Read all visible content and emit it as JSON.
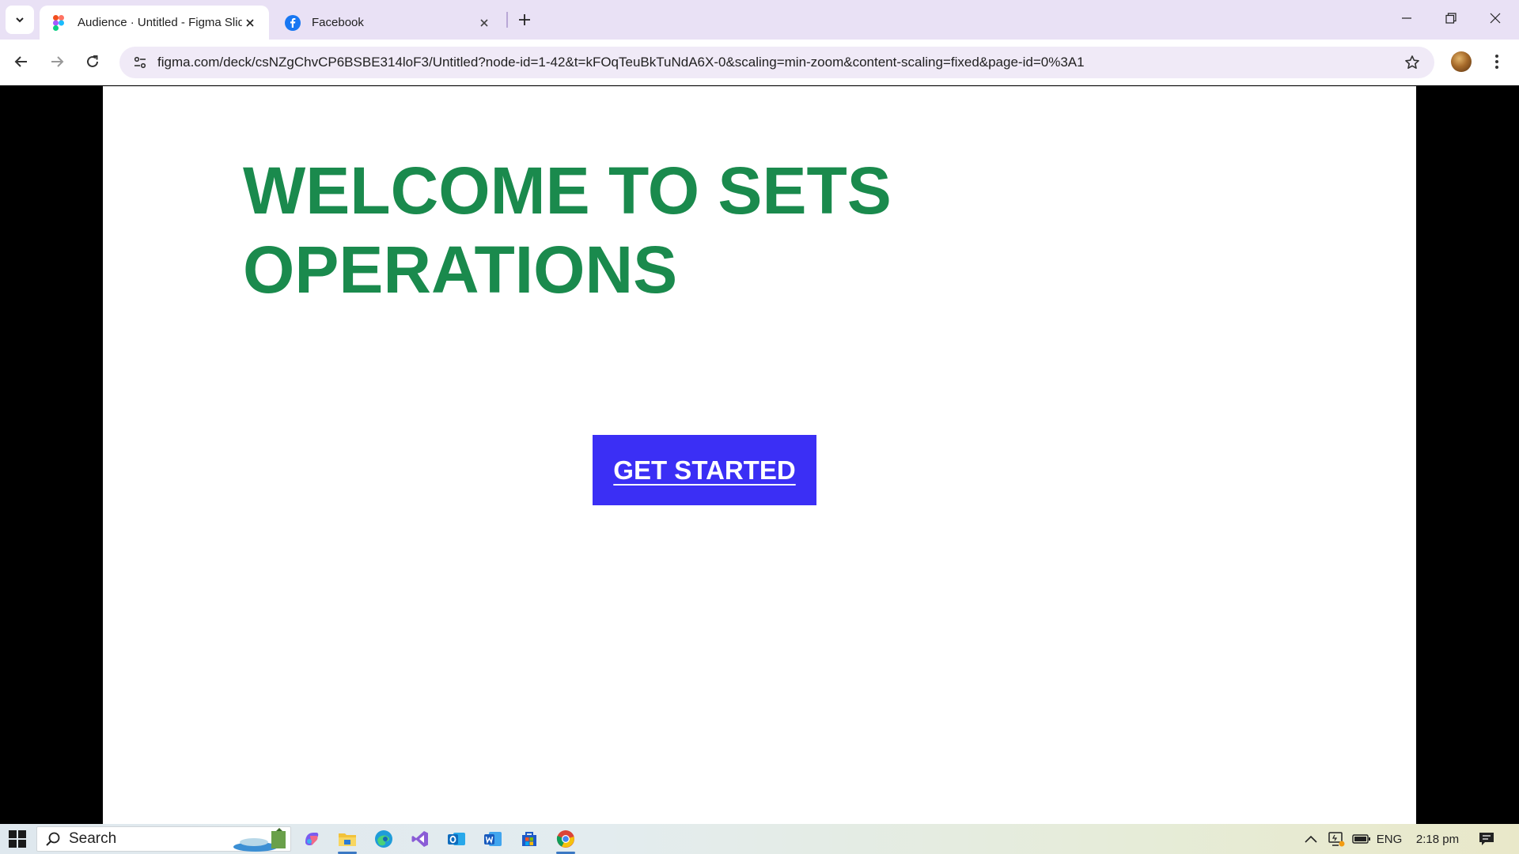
{
  "browser": {
    "tabs": [
      {
        "title": "Audience · Untitled - Figma Slides",
        "favicon": "figma-icon",
        "active": true
      },
      {
        "title": "Facebook",
        "favicon": "facebook-icon",
        "active": false
      }
    ],
    "url": "figma.com/deck/csNZgChvCP6BSBE314loF3/Untitled?node-id=1-42&t=kFOqTeuBkTuNdA6X-0&scaling=min-zoom&content-scaling=fixed&page-id=0%3A1"
  },
  "slide": {
    "headline_line1": "WELCOME TO SETS",
    "headline_line2": "OPERATIONS",
    "cta_label": "GET STARTED",
    "colors": {
      "headline": "#1a8a4d",
      "cta_bg": "#3b2ff5",
      "cta_text": "#ffffff"
    }
  },
  "taskbar": {
    "search_label": "Search",
    "apps": [
      "copilot-icon",
      "file-explorer-icon",
      "edge-icon",
      "visual-studio-icon",
      "outlook-icon",
      "word-icon",
      "store-icon",
      "chrome-icon"
    ],
    "language": "ENG",
    "time": "2:18 pm"
  }
}
